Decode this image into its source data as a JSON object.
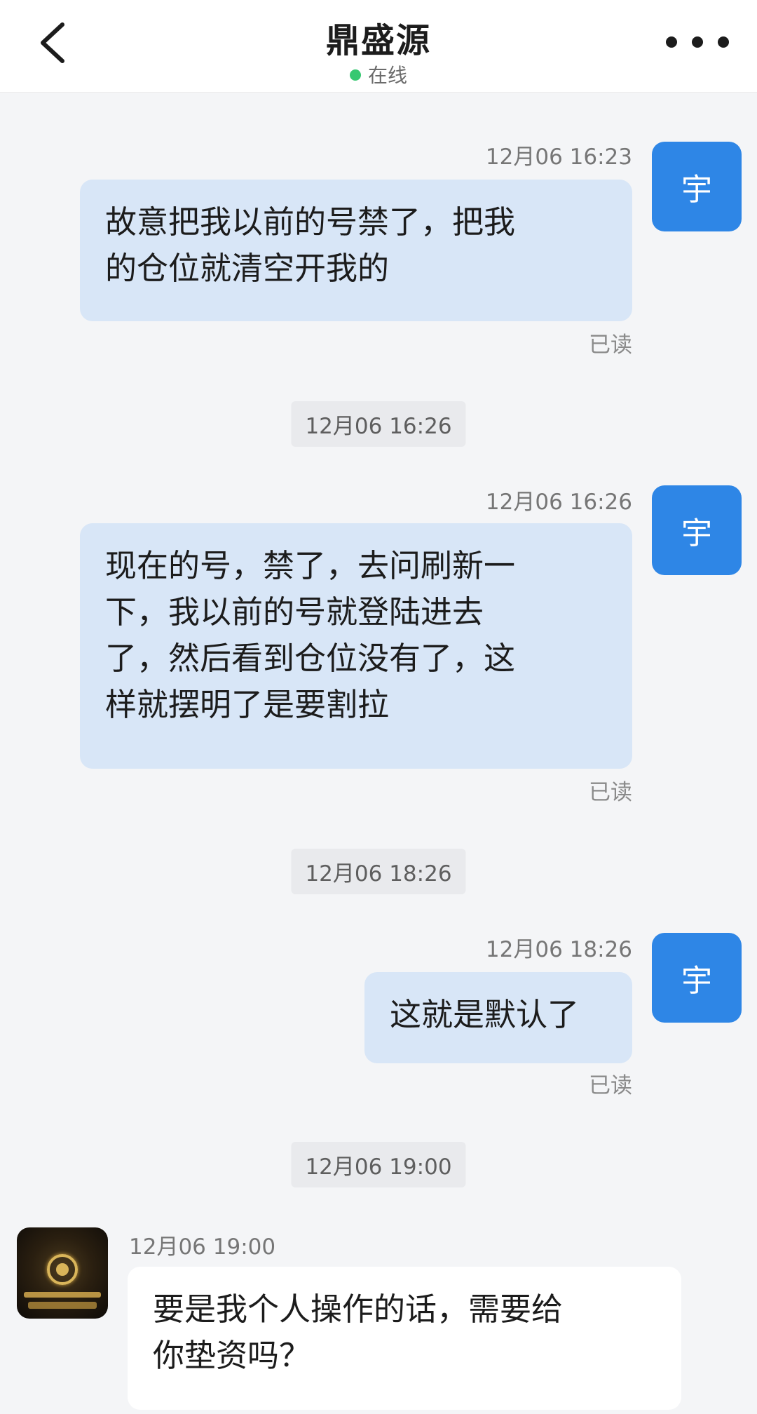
{
  "header": {
    "title": "鼎盛源",
    "status": "在线"
  },
  "colors": {
    "accent": "#2e86e6",
    "my_bubble": "#d8e6f7",
    "online_dot": "#37c871"
  },
  "messages": [
    {
      "time": "12月06 16:23",
      "avatar": "宇",
      "text_lines": [
        "故意把我以前的号禁了，把我",
        "的仓位就清空开我的"
      ],
      "read": "已读"
    },
    {
      "time": "12月06 16:26",
      "avatar": "宇",
      "text_lines": [
        "现在的号，禁了，去问刷新一",
        "下，我以前的号就登陆进去",
        "了，然后看到仓位没有了，这",
        "样就摆明了是要割拉"
      ],
      "read": "已读"
    },
    {
      "time": "12月06 18:26",
      "avatar": "宇",
      "text_lines": [
        "这就是默认了"
      ],
      "read": "已读"
    },
    {
      "time": "12月06 19:00",
      "text_lines": [
        "要是我个人操作的话，需要给",
        "你垫资吗？"
      ]
    }
  ],
  "separators": [
    "12月06 16:26",
    "12月06 18:26",
    "12月06 19:00"
  ],
  "icons": {
    "back": "chevron-left-icon",
    "more": "more-dots-icon"
  }
}
